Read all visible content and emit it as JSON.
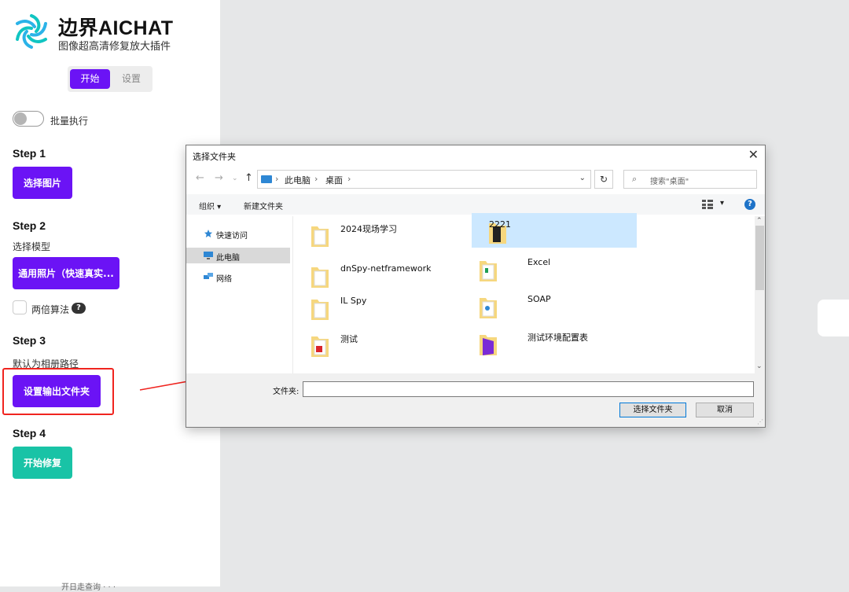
{
  "app": {
    "brand": "边界AICHAT",
    "subtitle": "图像超高清修复放大插件",
    "tabs": [
      "开始",
      "设置"
    ],
    "batch_label": "批量执行",
    "colors": {
      "accent": "#6b13f5",
      "teal": "#19c3a6",
      "highlight": "#f0241f"
    },
    "steps": [
      {
        "title": "Step 1",
        "desc": "",
        "button": "选择图片"
      },
      {
        "title": "Step 2",
        "desc": "选择模型",
        "button": "通用照片（快速真实..."
      },
      {
        "title": "Step 3",
        "desc": "默认为相册路径",
        "button": "设置输出文件夹"
      },
      {
        "title": "Step 4",
        "desc": "",
        "button": "开始修复"
      }
    ],
    "double_algo_label": "两倍算法",
    "help_icon": "?",
    "footer": "开日走查询  ·  ·  ·"
  },
  "dialog": {
    "title": "选择文件夹",
    "close": "✕",
    "nav": {
      "back": "←",
      "forward": "→",
      "recent": "⌄",
      "up": "↑",
      "refresh": "↻",
      "dropdown": "⌄"
    },
    "breadcrumb": [
      "此电脑",
      "桌面"
    ],
    "search_placeholder": "搜索\"桌面\"",
    "toolbar": {
      "organize": "组织 ▾",
      "new_folder": "新建文件夹"
    },
    "sidebar": [
      "快速访问",
      "此电脑",
      "网络"
    ],
    "files": [
      {
        "name": "2024现场学习",
        "icon": "folder-icon"
      },
      {
        "name": "2221",
        "icon": "folder-icon"
      },
      {
        "name": "dnSpy-netframework",
        "icon": "folder-icon"
      },
      {
        "name": "Excel",
        "icon": "folder-icon"
      },
      {
        "name": "IL Spy",
        "icon": "folder-icon"
      },
      {
        "name": "SOAP",
        "icon": "folder-icon"
      },
      {
        "name": "测试",
        "icon": "folder-icon"
      },
      {
        "name": "测试环境配置表",
        "icon": "app-icon"
      }
    ],
    "folder_label": "文件夹:",
    "folder_value": "",
    "select_button": "选择文件夹",
    "cancel_button": "取消"
  }
}
